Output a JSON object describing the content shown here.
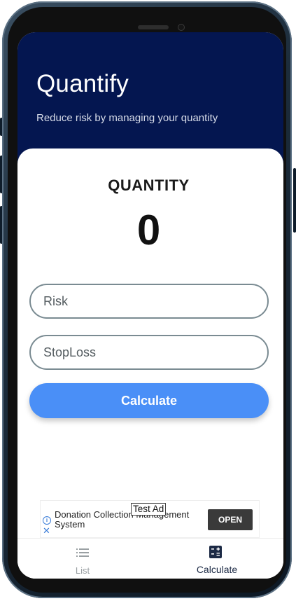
{
  "app": {
    "title": "Quantify",
    "subtitle": "Reduce risk by managing your quantity"
  },
  "result": {
    "label": "QUANTITY",
    "value": "0"
  },
  "form": {
    "risk_placeholder": "Risk",
    "stoploss_placeholder": "StopLoss",
    "calculate_label": "Calculate"
  },
  "ad": {
    "badge": "Test Ad",
    "text": "Donation Collection Management System",
    "open_label": "OPEN"
  },
  "nav": {
    "items": [
      {
        "label": "List",
        "icon": "list-icon",
        "active": false
      },
      {
        "label": "Calculate",
        "icon": "calculator-icon",
        "active": true
      }
    ]
  },
  "colors": {
    "header_bg": "#041650",
    "button_bg": "#4a8ff7",
    "field_border": "#7a8b92",
    "active_nav": "#1c2a45",
    "inactive_nav": "#9aa0a3"
  }
}
